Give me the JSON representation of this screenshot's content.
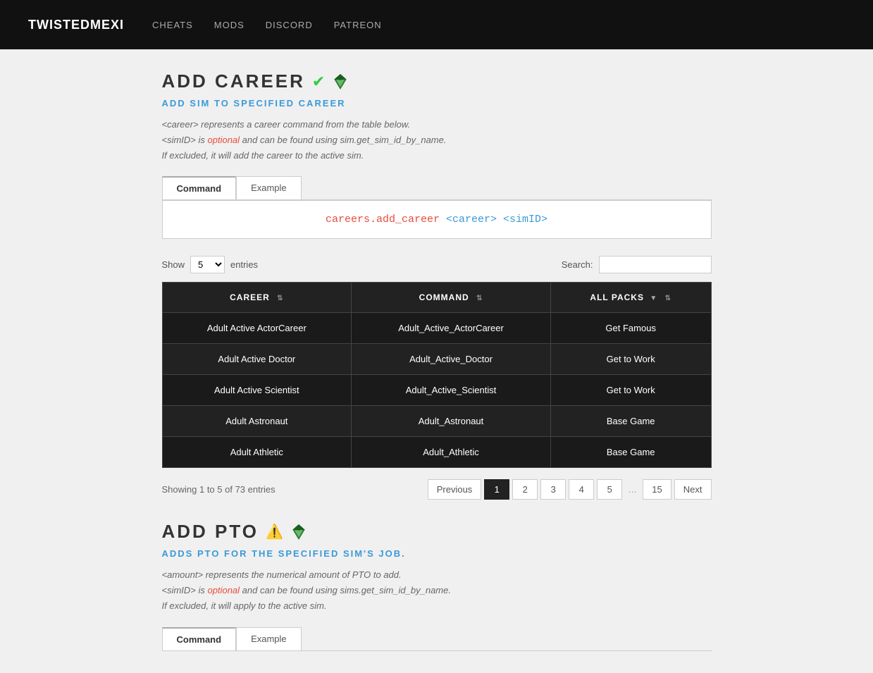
{
  "navbar": {
    "brand": "TWISTEDMEXI",
    "links": [
      "CHEATS",
      "MODS",
      "DISCORD",
      "PATREON"
    ]
  },
  "add_career": {
    "title": "ADD CAREER",
    "check_icon": "✔",
    "subtitle": "ADD SIM TO SPECIFIED CAREER",
    "description_lines": [
      "<career> represents a career command from the table below.",
      "<simID> is optional and can be found using sim.get_sim_id_by_name.",
      "If excluded, it will add the career to the active sim."
    ],
    "tabs": [
      "Command",
      "Example"
    ],
    "active_tab": "Command",
    "command_code": "careers.add_career <career> <simID>",
    "show_label": "Show",
    "show_value": "5",
    "entries_label": "entries",
    "search_label": "Search:",
    "search_placeholder": "",
    "table": {
      "columns": [
        "CAREER",
        "COMMAND",
        "ALL PACKS ▼"
      ],
      "rows": [
        [
          "Adult Active ActorCareer",
          "Adult_Active_ActorCareer",
          "Get Famous"
        ],
        [
          "Adult Active Doctor",
          "Adult_Active_Doctor",
          "Get to Work"
        ],
        [
          "Adult Active Scientist",
          "Adult_Active_Scientist",
          "Get to Work"
        ],
        [
          "Adult Astronaut",
          "Adult_Astronaut",
          "Base Game"
        ],
        [
          "Adult Athletic",
          "Adult_Athletic",
          "Base Game"
        ]
      ]
    },
    "showing_text": "Showing 1 to 5 of 73 entries",
    "pagination": {
      "prev_label": "Previous",
      "next_label": "Next",
      "pages": [
        "1",
        "2",
        "3",
        "4",
        "5",
        "…",
        "15"
      ],
      "active_page": "1"
    }
  },
  "add_pto": {
    "title": "ADD PTO",
    "warning_icon": "⚠️",
    "subtitle": "ADDS PTO FOR THE SPECIFIED SIM'S JOB.",
    "description_lines": [
      "<amount> represents the numerical amount of PTO to add.",
      "<simID> is optional and can be found using sims.get_sim_id_by_name.",
      "If excluded, it will apply to the active sim."
    ],
    "tabs": [
      "Command",
      "Example"
    ],
    "active_tab": "Command"
  }
}
